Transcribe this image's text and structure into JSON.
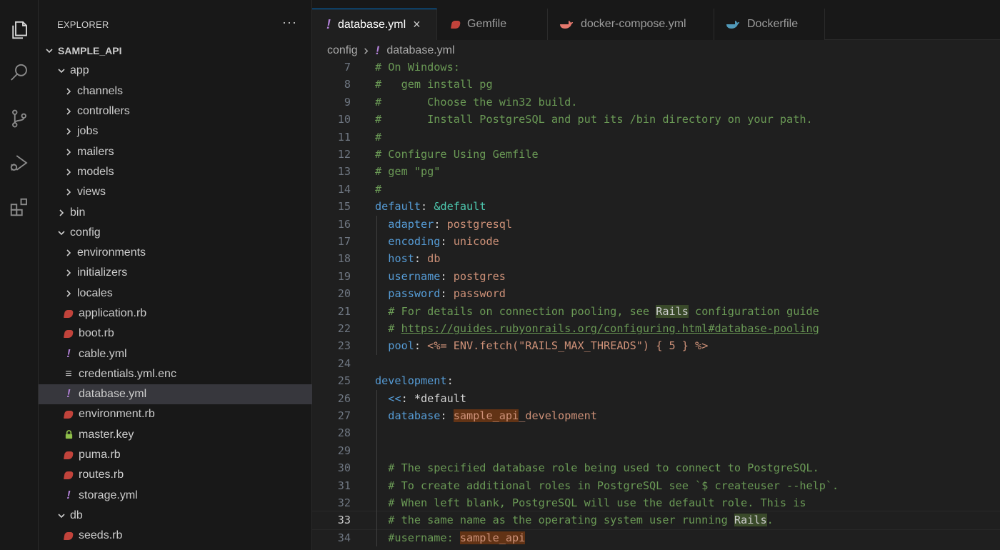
{
  "sidebar": {
    "title": "EXPLORER",
    "more": "···",
    "tree": [
      {
        "label": "SAMPLE_API",
        "depth": 0,
        "type": "root",
        "expanded": true
      },
      {
        "label": "app",
        "depth": 1,
        "type": "folder",
        "expanded": true
      },
      {
        "label": "channels",
        "depth": 2,
        "type": "folder",
        "expanded": false
      },
      {
        "label": "controllers",
        "depth": 2,
        "type": "folder",
        "expanded": false
      },
      {
        "label": "jobs",
        "depth": 2,
        "type": "folder",
        "expanded": false
      },
      {
        "label": "mailers",
        "depth": 2,
        "type": "folder",
        "expanded": false
      },
      {
        "label": "models",
        "depth": 2,
        "type": "folder",
        "expanded": false
      },
      {
        "label": "views",
        "depth": 2,
        "type": "folder",
        "expanded": false
      },
      {
        "label": "bin",
        "depth": 1,
        "type": "folder",
        "expanded": false
      },
      {
        "label": "config",
        "depth": 1,
        "type": "folder",
        "expanded": true
      },
      {
        "label": "environments",
        "depth": 2,
        "type": "folder",
        "expanded": false
      },
      {
        "label": "initializers",
        "depth": 2,
        "type": "folder",
        "expanded": false
      },
      {
        "label": "locales",
        "depth": 2,
        "type": "folder",
        "expanded": false
      },
      {
        "label": "application.rb",
        "depth": 2,
        "type": "ruby"
      },
      {
        "label": "boot.rb",
        "depth": 2,
        "type": "ruby"
      },
      {
        "label": "cable.yml",
        "depth": 2,
        "type": "yml"
      },
      {
        "label": "credentials.yml.enc",
        "depth": 2,
        "type": "enc"
      },
      {
        "label": "database.yml",
        "depth": 2,
        "type": "yml",
        "selected": true
      },
      {
        "label": "environment.rb",
        "depth": 2,
        "type": "ruby"
      },
      {
        "label": "master.key",
        "depth": 2,
        "type": "key"
      },
      {
        "label": "puma.rb",
        "depth": 2,
        "type": "ruby"
      },
      {
        "label": "routes.rb",
        "depth": 2,
        "type": "ruby"
      },
      {
        "label": "storage.yml",
        "depth": 2,
        "type": "yml"
      },
      {
        "label": "db",
        "depth": 1,
        "type": "folder",
        "expanded": true
      },
      {
        "label": "seeds.rb",
        "depth": 2,
        "type": "ruby"
      }
    ]
  },
  "tabs": [
    {
      "label": "database.yml",
      "icon": "yml",
      "active": true,
      "close": "×"
    },
    {
      "label": "Gemfile",
      "icon": "ruby",
      "active": false
    },
    {
      "label": "docker-compose.yml",
      "icon": "docker",
      "active": false
    },
    {
      "label": "Dockerfile",
      "icon": "docker",
      "active": false
    }
  ],
  "breadcrumb": {
    "folder": "config",
    "file": "database.yml",
    "file_icon": "!"
  },
  "editor": {
    "current_line": 33,
    "lines": [
      {
        "n": "7",
        "t": [
          [
            "c",
            "# On Windows:"
          ]
        ]
      },
      {
        "n": "8",
        "t": [
          [
            "c",
            "#   gem install pg"
          ]
        ]
      },
      {
        "n": "9",
        "t": [
          [
            "c",
            "#       Choose the win32 build."
          ]
        ]
      },
      {
        "n": "10",
        "t": [
          [
            "c",
            "#       Install PostgreSQL and put its /bin directory on your path."
          ]
        ]
      },
      {
        "n": "11",
        "t": [
          [
            "c",
            "#"
          ]
        ]
      },
      {
        "n": "12",
        "t": [
          [
            "c",
            "# Configure Using Gemfile"
          ]
        ]
      },
      {
        "n": "13",
        "t": [
          [
            "c",
            "# gem \"pg\""
          ]
        ]
      },
      {
        "n": "14",
        "t": [
          [
            "c",
            "#"
          ]
        ]
      },
      {
        "n": "15",
        "t": [
          [
            "k",
            "default"
          ],
          [
            "p",
            ": "
          ],
          [
            "a",
            "&default"
          ]
        ]
      },
      {
        "n": "16",
        "t": [
          [
            "p",
            "  "
          ],
          [
            "k",
            "adapter"
          ],
          [
            "p",
            ": "
          ],
          [
            "s",
            "postgresql"
          ]
        ]
      },
      {
        "n": "17",
        "t": [
          [
            "p",
            "  "
          ],
          [
            "k",
            "encoding"
          ],
          [
            "p",
            ": "
          ],
          [
            "s",
            "unicode"
          ]
        ]
      },
      {
        "n": "18",
        "t": [
          [
            "p",
            "  "
          ],
          [
            "k",
            "host"
          ],
          [
            "p",
            ": "
          ],
          [
            "s",
            "db"
          ]
        ]
      },
      {
        "n": "19",
        "t": [
          [
            "p",
            "  "
          ],
          [
            "k",
            "username"
          ],
          [
            "p",
            ": "
          ],
          [
            "s",
            "postgres"
          ]
        ]
      },
      {
        "n": "20",
        "t": [
          [
            "p",
            "  "
          ],
          [
            "k",
            "password"
          ],
          [
            "p",
            ": "
          ],
          [
            "s",
            "password"
          ]
        ]
      },
      {
        "n": "21",
        "t": [
          [
            "c",
            "  # For details on connection pooling, see "
          ],
          [
            "hl",
            "Rails"
          ],
          [
            "c",
            " configuration guide"
          ]
        ]
      },
      {
        "n": "22",
        "t": [
          [
            "c",
            "  # "
          ],
          [
            "u",
            "https://guides.rubyonrails.org/configuring.html#database-pooling"
          ]
        ]
      },
      {
        "n": "23",
        "t": [
          [
            "p",
            "  "
          ],
          [
            "k",
            "pool"
          ],
          [
            "p",
            ": "
          ],
          [
            "s",
            "<%= ENV.fetch(\"RAILS_MAX_THREADS\") { 5 } %>"
          ]
        ]
      },
      {
        "n": "24",
        "t": []
      },
      {
        "n": "25",
        "t": [
          [
            "k",
            "development"
          ],
          [
            "p",
            ":"
          ]
        ]
      },
      {
        "n": "26",
        "t": [
          [
            "p",
            "  "
          ],
          [
            "k",
            "<<"
          ],
          [
            "p",
            ": "
          ],
          [
            "w",
            "*default"
          ]
        ]
      },
      {
        "n": "27",
        "t": [
          [
            "p",
            "  "
          ],
          [
            "k",
            "database"
          ],
          [
            "p",
            ": "
          ],
          [
            "hl2",
            "sample_api"
          ],
          [
            "s",
            "_development"
          ]
        ]
      },
      {
        "n": "28",
        "t": []
      },
      {
        "n": "29",
        "t": []
      },
      {
        "n": "30",
        "t": [
          [
            "c",
            "  # The specified database role being used to connect to PostgreSQL."
          ]
        ]
      },
      {
        "n": "31",
        "t": [
          [
            "c",
            "  # To create additional roles in PostgreSQL see `$ createuser --help`."
          ]
        ]
      },
      {
        "n": "32",
        "t": [
          [
            "c",
            "  # When left blank, PostgreSQL will use the default role. This is"
          ]
        ]
      },
      {
        "n": "33",
        "t": [
          [
            "c",
            "  # the same name as the operating system user running "
          ],
          [
            "hl",
            "Rails"
          ],
          [
            "c",
            "."
          ]
        ]
      },
      {
        "n": "34",
        "t": [
          [
            "c",
            "  #username: "
          ],
          [
            "hl2s",
            "sample_api"
          ]
        ]
      }
    ]
  }
}
